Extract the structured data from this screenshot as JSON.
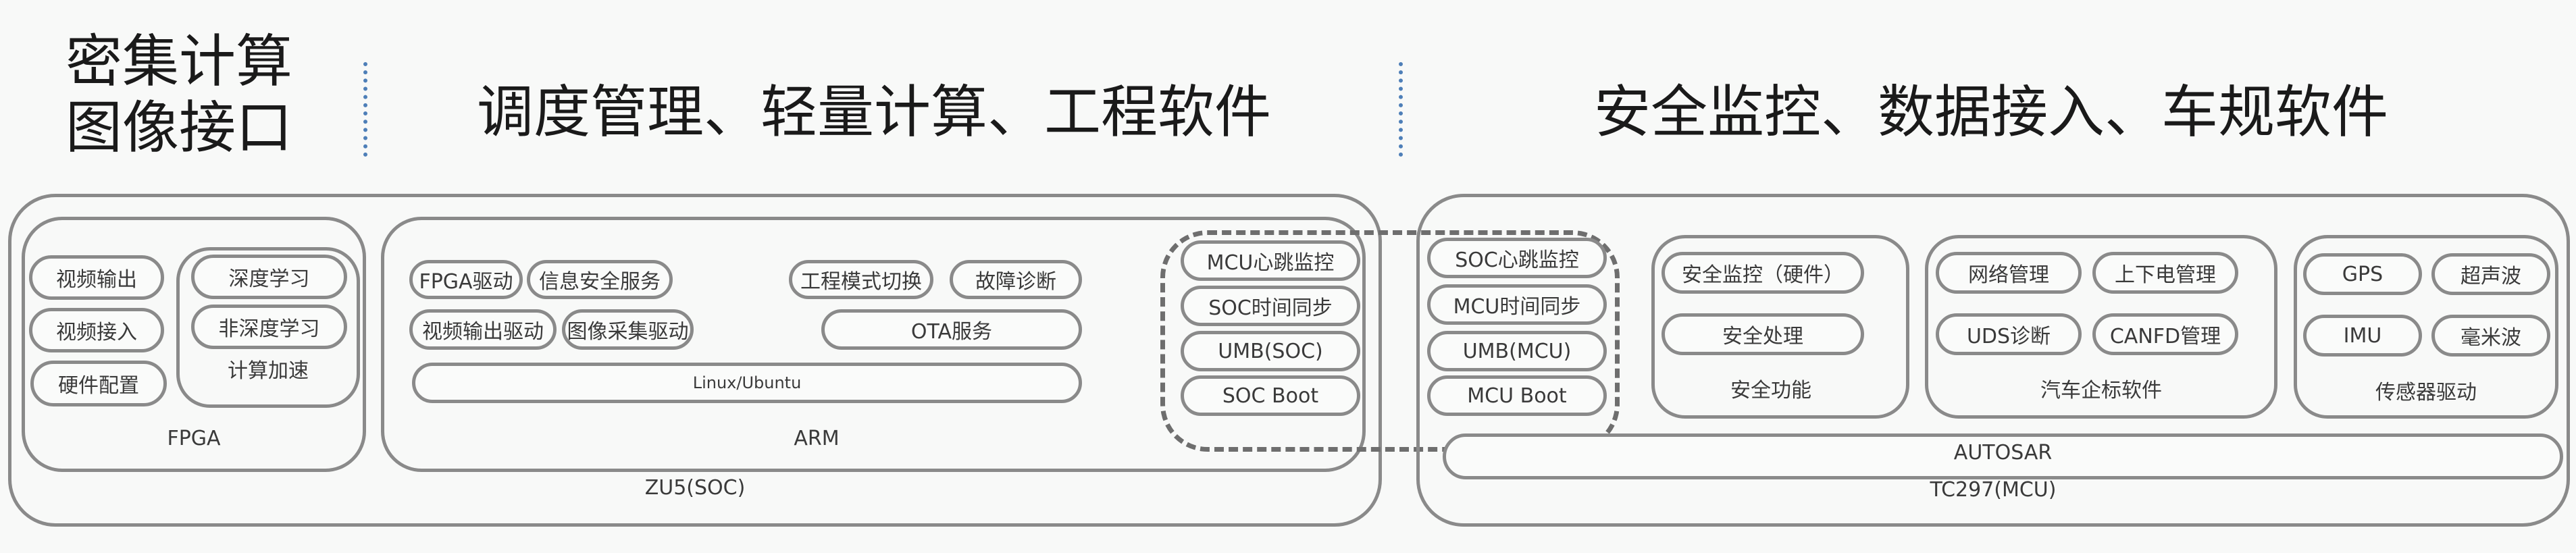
{
  "headers": {
    "compute_line1": "密集计算",
    "compute_line2": "图像接口",
    "arm_title": "调度管理、轻量计算、工程软件",
    "mcu_title": "安全监控、数据接入、车规软件"
  },
  "colors": {
    "border": "#8a8a8a",
    "separator": "#4e7fb8",
    "background": "#f8f9f8",
    "text": "#3a3a3a"
  },
  "soc": {
    "label": "ZU5(SOC)",
    "fpga": {
      "label": "FPGA",
      "io_items": [
        "视频输出",
        "视频接入",
        "硬件配置"
      ],
      "accel": {
        "label": "计算加速",
        "items": [
          "深度学习",
          "非深度学习"
        ]
      }
    },
    "arm": {
      "label": "ARM",
      "row1": [
        "FPGA驱动",
        "信息安全服务",
        "工程模式切换",
        "故障诊断"
      ],
      "row2": [
        "视频输出驱动",
        "图像采集驱动",
        "OTA服务"
      ],
      "os": "Linux/Ubuntu"
    },
    "interconnect": [
      "MCU心跳监控",
      "SOC时间同步",
      "UMB(SOC)",
      "SOC Boot"
    ]
  },
  "mcu": {
    "label": "TC297(MCU)",
    "interconnect": [
      "SOC心跳监控",
      "MCU时间同步",
      "UMB(MCU)",
      "MCU Boot"
    ],
    "safety": {
      "label": "安全功能",
      "items": [
        "安全监控（硬件）",
        "安全处理"
      ]
    },
    "auto_std": {
      "label": "汽车企标软件",
      "items": [
        "网络管理",
        "上下电管理",
        "UDS诊断",
        "CANFD管理"
      ]
    },
    "sensors": {
      "label": "传感器驱动",
      "items": [
        "GPS",
        "超声波",
        "IMU",
        "毫米波"
      ]
    },
    "autosar": "AUTOSAR"
  }
}
